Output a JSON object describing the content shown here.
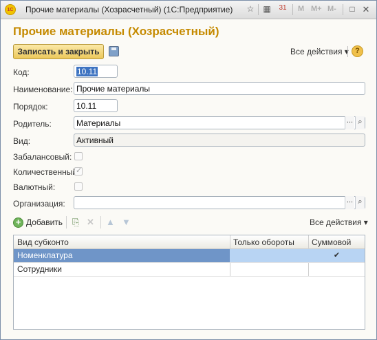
{
  "window": {
    "title": "Прочие материалы (Хозрасчетный)  (1С:Предприятие)",
    "app_icon_text": "1С",
    "m_buttons": [
      "M",
      "M+",
      "M-"
    ]
  },
  "form": {
    "title": "Прочие материалы (Хозрасчетный)",
    "save_close_label": "Записать и закрыть",
    "all_actions_label": "Все действия ▾",
    "help_label": "?"
  },
  "fields": {
    "code_label": "Код:",
    "code_value": "10.11",
    "name_label": "Наименование:",
    "name_value": "Прочие материалы",
    "order_label": "Порядок:",
    "order_value": "10.11",
    "parent_label": "Родитель:",
    "parent_value": "Материалы",
    "kind_label": "Вид:",
    "kind_value": "Активный",
    "offbalance_label": "Забалансовый:",
    "offbalance_checked": false,
    "quantity_label": "Количественный:",
    "quantity_checked": true,
    "currency_label": "Валютный:",
    "currency_checked": false,
    "organization_label": "Организация:",
    "organization_value": ""
  },
  "subconto": {
    "add_label": "Добавить",
    "all_actions_label": "Все действия ▾",
    "columns": [
      "Вид субконто",
      "Только обороты",
      "Суммовой"
    ],
    "rows": [
      {
        "kind": "Номенклатура",
        "turnover_only": "",
        "sum": "✔"
      },
      {
        "kind": "Сотрудники",
        "turnover_only": "",
        "sum": ""
      }
    ]
  },
  "colors": {
    "title_color": "#c58a00",
    "selection": "#3d73c1",
    "row_selected": "#b8d4f3"
  }
}
